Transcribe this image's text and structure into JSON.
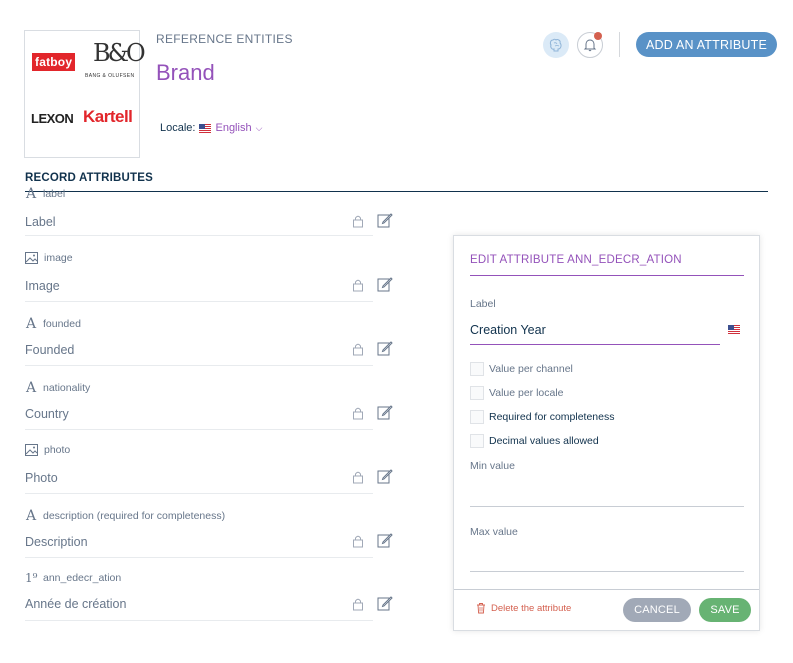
{
  "header": {
    "logos": [
      "fatboy",
      "B&O",
      "BANG & OLUFSEN",
      "LEXON",
      "Kartell"
    ],
    "subtitle": "REFERENCE ENTITIES",
    "title": "Brand",
    "locale_label": "Locale:",
    "locale_value": "English",
    "add_button": "ADD AN ATTRIBUTE",
    "help_icon": "brain-help-icon",
    "bell_icon": "bell-icon"
  },
  "section_title": "RECORD ATTRIBUTES",
  "attributes": [
    {
      "type_icon": "A",
      "code": "label",
      "label": "Label"
    },
    {
      "type_icon": "image-icon",
      "code": "image",
      "label": "Image"
    },
    {
      "type_icon": "A",
      "code": "founded",
      "label": "Founded"
    },
    {
      "type_icon": "A",
      "code": "nationality",
      "label": "Country"
    },
    {
      "type_icon": "image-icon",
      "code": "photo",
      "label": "Photo"
    },
    {
      "type_icon": "A",
      "code": "description (required for completeness)",
      "label": "Description"
    },
    {
      "type_icon": "1⁹",
      "code": "ann_edecr_ation",
      "label": "Année de création"
    }
  ],
  "panel": {
    "title": "EDIT ATTRIBUTE ANN_EDECR_ATION",
    "label_field_label": "Label",
    "label_value": "Creation Year",
    "checkboxes": [
      {
        "label": "Value per channel",
        "checked": false
      },
      {
        "label": "Value per locale",
        "checked": false
      },
      {
        "label": "Required for completeness",
        "checked": false
      },
      {
        "label": "Decimal values allowed",
        "checked": false
      }
    ],
    "min_label": "Min value",
    "min_value": "",
    "max_label": "Max value",
    "max_value": "",
    "delete_label": "Delete the attribute",
    "cancel_label": "CANCEL",
    "save_label": "SAVE"
  },
  "colors": {
    "accent_purple": "#9452ba",
    "primary_blue": "#5992c7",
    "save_green": "#67b373",
    "cancel_grey": "#a1a9b7",
    "danger_red": "#d4604f"
  }
}
